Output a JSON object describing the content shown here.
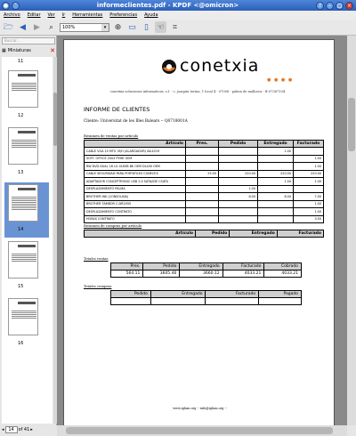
{
  "window": {
    "title": "informeclientes.pdf - KPDF <@omicron>"
  },
  "menu": [
    "Archivo",
    "Editar",
    "Ver",
    "Ir",
    "Herramientas",
    "Preferencias",
    "Ayuda"
  ],
  "toolbar": {
    "zoom": "100%"
  },
  "sidebar": {
    "search_placeholder": "Buscar...",
    "tab_label": "Miniaturas",
    "pages": [
      "11",
      "12",
      "13",
      "14",
      "15",
      "16"
    ],
    "current_page": "14",
    "total_pages": "of 41"
  },
  "doc": {
    "logo_text": "conetxia",
    "logo_dots": "● ● ● ●",
    "company_line": "conetxia soluciones informaticas, s.l. - c. joaquin torina, 1 local 4 - 07008 - palma de mallorca - B-07367104",
    "report_title": "INFORME DE CLIENTES",
    "client_line": "Cliente: Universitat de les Illes Balears -- Q0718001A",
    "section_sales": "Resumen de ventas por artículo",
    "sales_headers": [
      "Artículo",
      "Pres.",
      "Pedido",
      "Entregado",
      "Facturado"
    ],
    "sales_rows": [
      [
        "CABLE VGA 10 MTS. M/H (ALARGADOR) AK-4219",
        "",
        "",
        "1.00",
        ""
      ],
      [
        "SOFT. OFFICE 2003 PYME OEM",
        "",
        "",
        "",
        "1.00"
      ],
      [
        "RW DVD DUAL 16 LG 4163B BK OEM DL400 OEM",
        "",
        "",
        "",
        "1.00"
      ],
      [
        "CABLE SEGURIDAD PARA PORTATILES CONECEX",
        "25.00",
        "220.00",
        "220.00",
        "220.00"
      ],
      [
        "ADAPTADOR CONCEPTRONIC USB 2.0 SATA/IDE CSATA",
        "",
        "",
        "1.00",
        "1.00"
      ],
      [
        "DESPLAZAMIENTO PALMA",
        "",
        "1.00",
        "",
        ""
      ],
      [
        "BROTHER INK (CONSOLIDA)",
        "",
        "8.00",
        "8.00",
        "7.00"
      ],
      [
        "BROTHER TAMBOR C-DR2050",
        "",
        "",
        "",
        "1.00"
      ],
      [
        "DESPLAZAMIENTO CONTRATO",
        "",
        "",
        "",
        "1.00"
      ],
      [
        "HORAS CONTRATO",
        "",
        "",
        "",
        "3.50"
      ]
    ],
    "section_purchases": "Resumen de compras por artículo",
    "purchase_headers": [
      "Artículo",
      "Pedido",
      "Entregado",
      "Facturado"
    ],
    "section_sales_totals": "Totales ventas",
    "sales_total_headers": [
      "Pres.",
      "Pedido",
      "Entregado",
      "Facturado",
      "Cobrado"
    ],
    "sales_total_values": [
      "564.11",
      "3605.46",
      "3660.12",
      "4033.21",
      "4033.21"
    ],
    "section_purchase_totals": "Totales compras",
    "purchase_total_headers": [
      "Pedido",
      "Entregado",
      "Facturado",
      "Pagado"
    ],
    "footer": "www.iglum.org -- info@iglum.org --"
  },
  "colors": {
    "titlebar": "#2a5fb8",
    "logo_orange": "#e87520",
    "table_header": "#cfcfcf"
  }
}
